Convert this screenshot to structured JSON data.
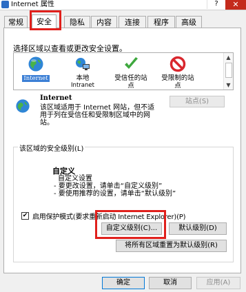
{
  "window": {
    "title": "Internet 属性",
    "help": "?",
    "close": "✕"
  },
  "tabs": [
    {
      "label": "常规"
    },
    {
      "label": "安全"
    },
    {
      "label": "隐私"
    },
    {
      "label": "内容"
    },
    {
      "label": "连接"
    },
    {
      "label": "程序"
    },
    {
      "label": "高级"
    }
  ],
  "security": {
    "zone_prompt": "选择区域以查看或更改安全设置。",
    "zones": [
      {
        "label": "Internet",
        "icon": "globe-icon",
        "selected": true
      },
      {
        "label": "本地 Intranet",
        "line1": "本地",
        "line2": "Intranet",
        "icon": "intranet-icon"
      },
      {
        "label": "受信任的站点",
        "line1": "受信任的站",
        "line2": "点",
        "icon": "checkmark-icon"
      },
      {
        "label": "受限制的站点",
        "line1": "受限制的站",
        "line2": "点",
        "icon": "restricted-icon"
      }
    ],
    "zone_info": {
      "name": "Internet",
      "desc": "该区域适用于 Internet 网站，但不适用于列在受信任和受限制区域中的网站。"
    },
    "sites_button": "站点(S)",
    "level_group_label": "该区域的安全级别(L)",
    "level_title": "自定义",
    "level_lines": [
      "自定义设置",
      "- 要更改设置，请单击“自定义级别”",
      "- 要使用推荐的设置，请单击“默认级别”"
    ],
    "protected_mode_label": "启用保护模式(要求重新启动 Internet Explorer)(P)",
    "protected_mode_checked": true,
    "custom_level_button": "自定义级别(C)...",
    "default_level_button": "默认级别(D)",
    "reset_all_button": "将所有区域重置为默认级别(R)"
  },
  "footer": {
    "ok": "确定",
    "cancel": "取消",
    "apply": "应用(A)"
  },
  "colors": {
    "highlight": "#e0201c",
    "selection": "#3b7fd5",
    "close": "#c42b1c"
  }
}
